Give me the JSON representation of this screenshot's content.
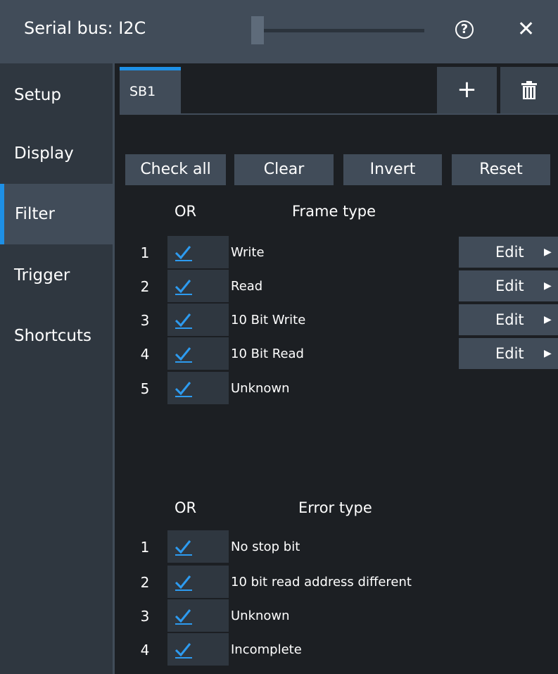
{
  "titlebar": {
    "title": "Serial bus: I2C",
    "slider_level": 0.05,
    "help_label": "?",
    "close_label": "✕"
  },
  "sidebar": {
    "items": [
      {
        "label": "Setup",
        "active": false
      },
      {
        "label": "Display",
        "active": false
      },
      {
        "label": "Filter",
        "active": true
      },
      {
        "label": "Trigger",
        "active": false
      },
      {
        "label": "Shortcuts",
        "active": false
      }
    ]
  },
  "tabs": {
    "items": [
      {
        "label": "SB1",
        "active": true
      }
    ],
    "add_label": "+",
    "delete_icon": "trash-icon"
  },
  "actions": {
    "check_all": "Check all",
    "clear": "Clear",
    "invert": "Invert",
    "reset": "Reset"
  },
  "frame_section": {
    "or_header": "OR",
    "type_header": "Frame type",
    "edit_label": "Edit",
    "rows": [
      {
        "num": "1",
        "label": "Write",
        "checked": true,
        "has_edit": true
      },
      {
        "num": "2",
        "label": "Read",
        "checked": true,
        "has_edit": true
      },
      {
        "num": "3",
        "label": "10 Bit Write",
        "checked": true,
        "has_edit": true
      },
      {
        "num": "4",
        "label": "10 Bit Read",
        "checked": true,
        "has_edit": true
      },
      {
        "num": "5",
        "label": "Unknown",
        "checked": true,
        "has_edit": false
      }
    ]
  },
  "error_section": {
    "or_header": "OR",
    "type_header": "Error type",
    "rows": [
      {
        "num": "1",
        "label": "No stop bit",
        "checked": true
      },
      {
        "num": "2",
        "label": "10 bit read address different",
        "checked": true
      },
      {
        "num": "3",
        "label": "Unknown",
        "checked": true
      },
      {
        "num": "4",
        "label": "Incomplete",
        "checked": true
      }
    ]
  },
  "colors": {
    "accent": "#1e90e6",
    "panel": "#414c59",
    "background": "#1c1f23",
    "check": "#2d9bf0"
  }
}
